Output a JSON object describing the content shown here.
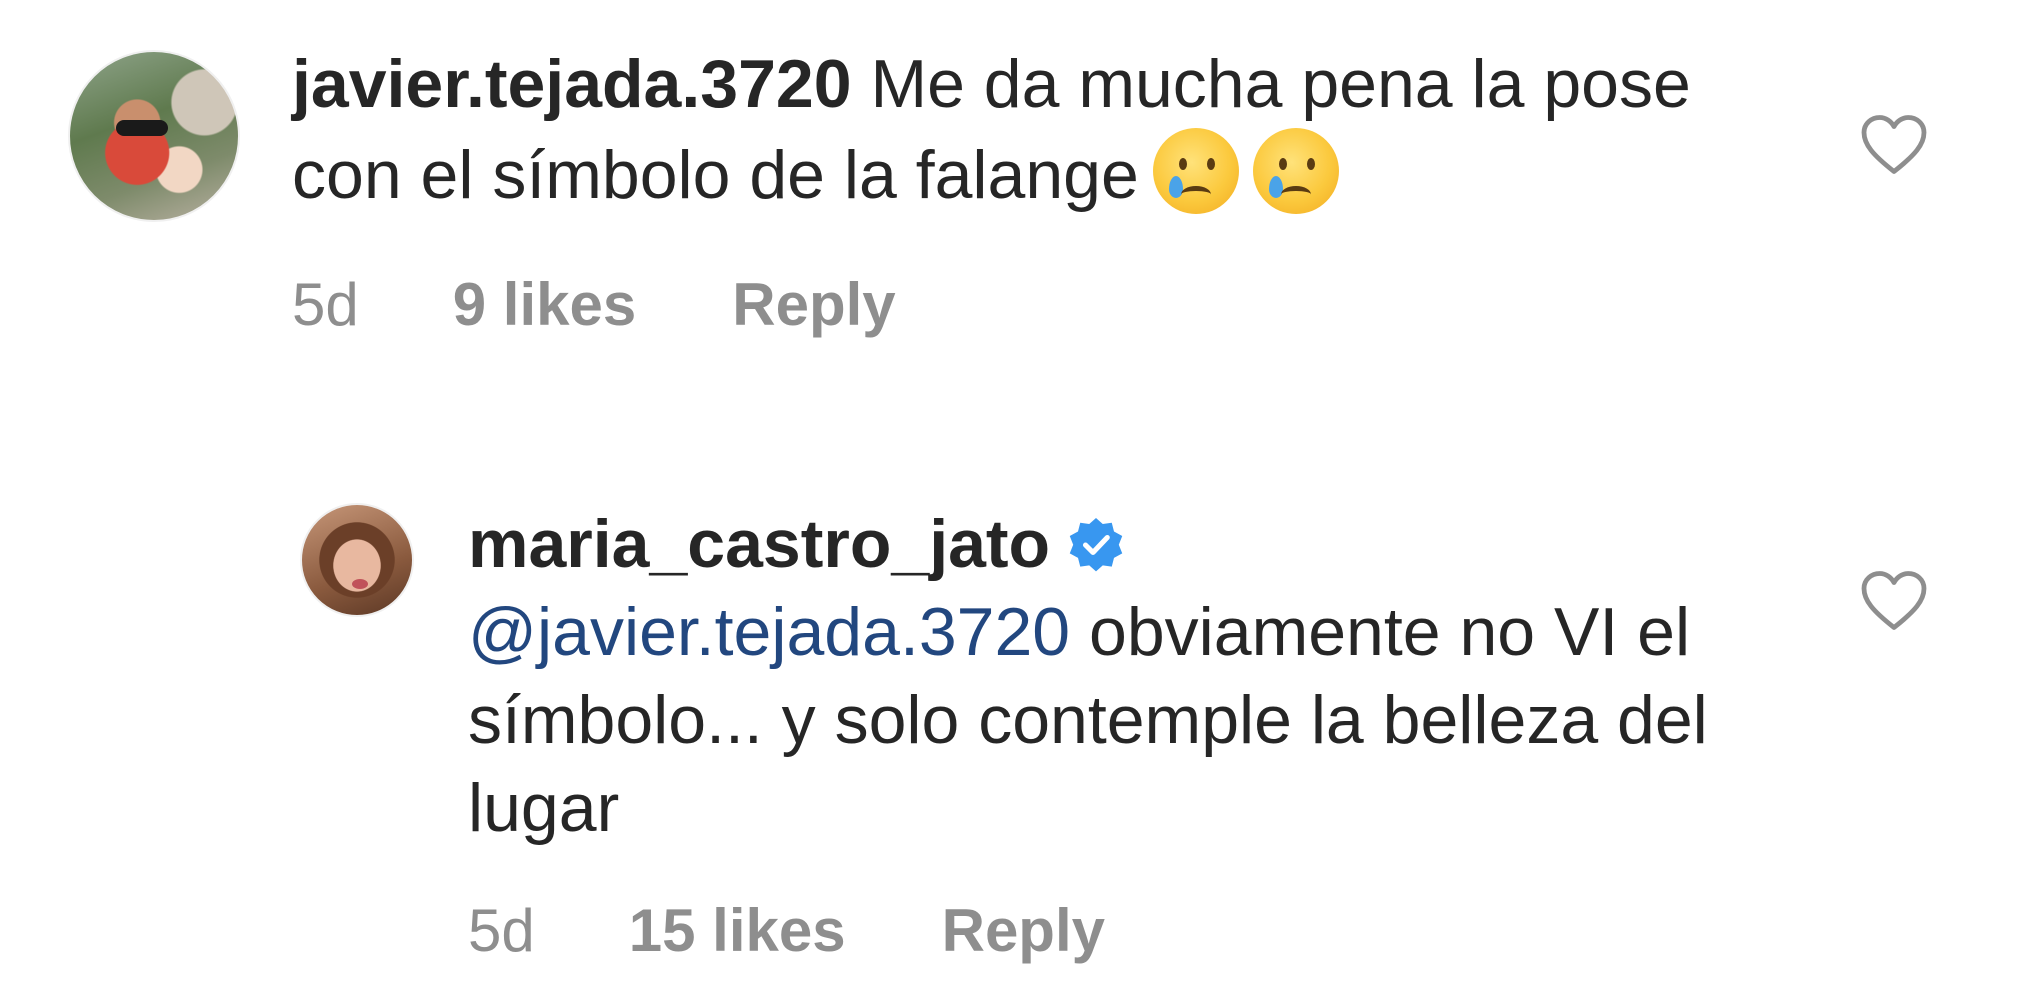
{
  "comments": [
    {
      "username": "javier.tejada.3720",
      "text": "Me da mucha pena la pose con el símbolo  de la falange",
      "emojis": [
        "crying-face-icon",
        "crying-face-icon"
      ],
      "time": "5d",
      "likes": "9 likes",
      "reply_label": "Reply",
      "verified": false
    },
    {
      "username": "maria_castro_jato",
      "verified": true,
      "mention": "@javier.tejada.3720",
      "text": "obviamente no VI el símbolo... y solo contemple la belleza del lugar",
      "time": "5d",
      "likes": "15 likes",
      "reply_label": "Reply"
    }
  ],
  "colors": {
    "text": "#262626",
    "meta": "#8e8e8e",
    "mention": "#22477f",
    "verified": "#3897f0"
  }
}
